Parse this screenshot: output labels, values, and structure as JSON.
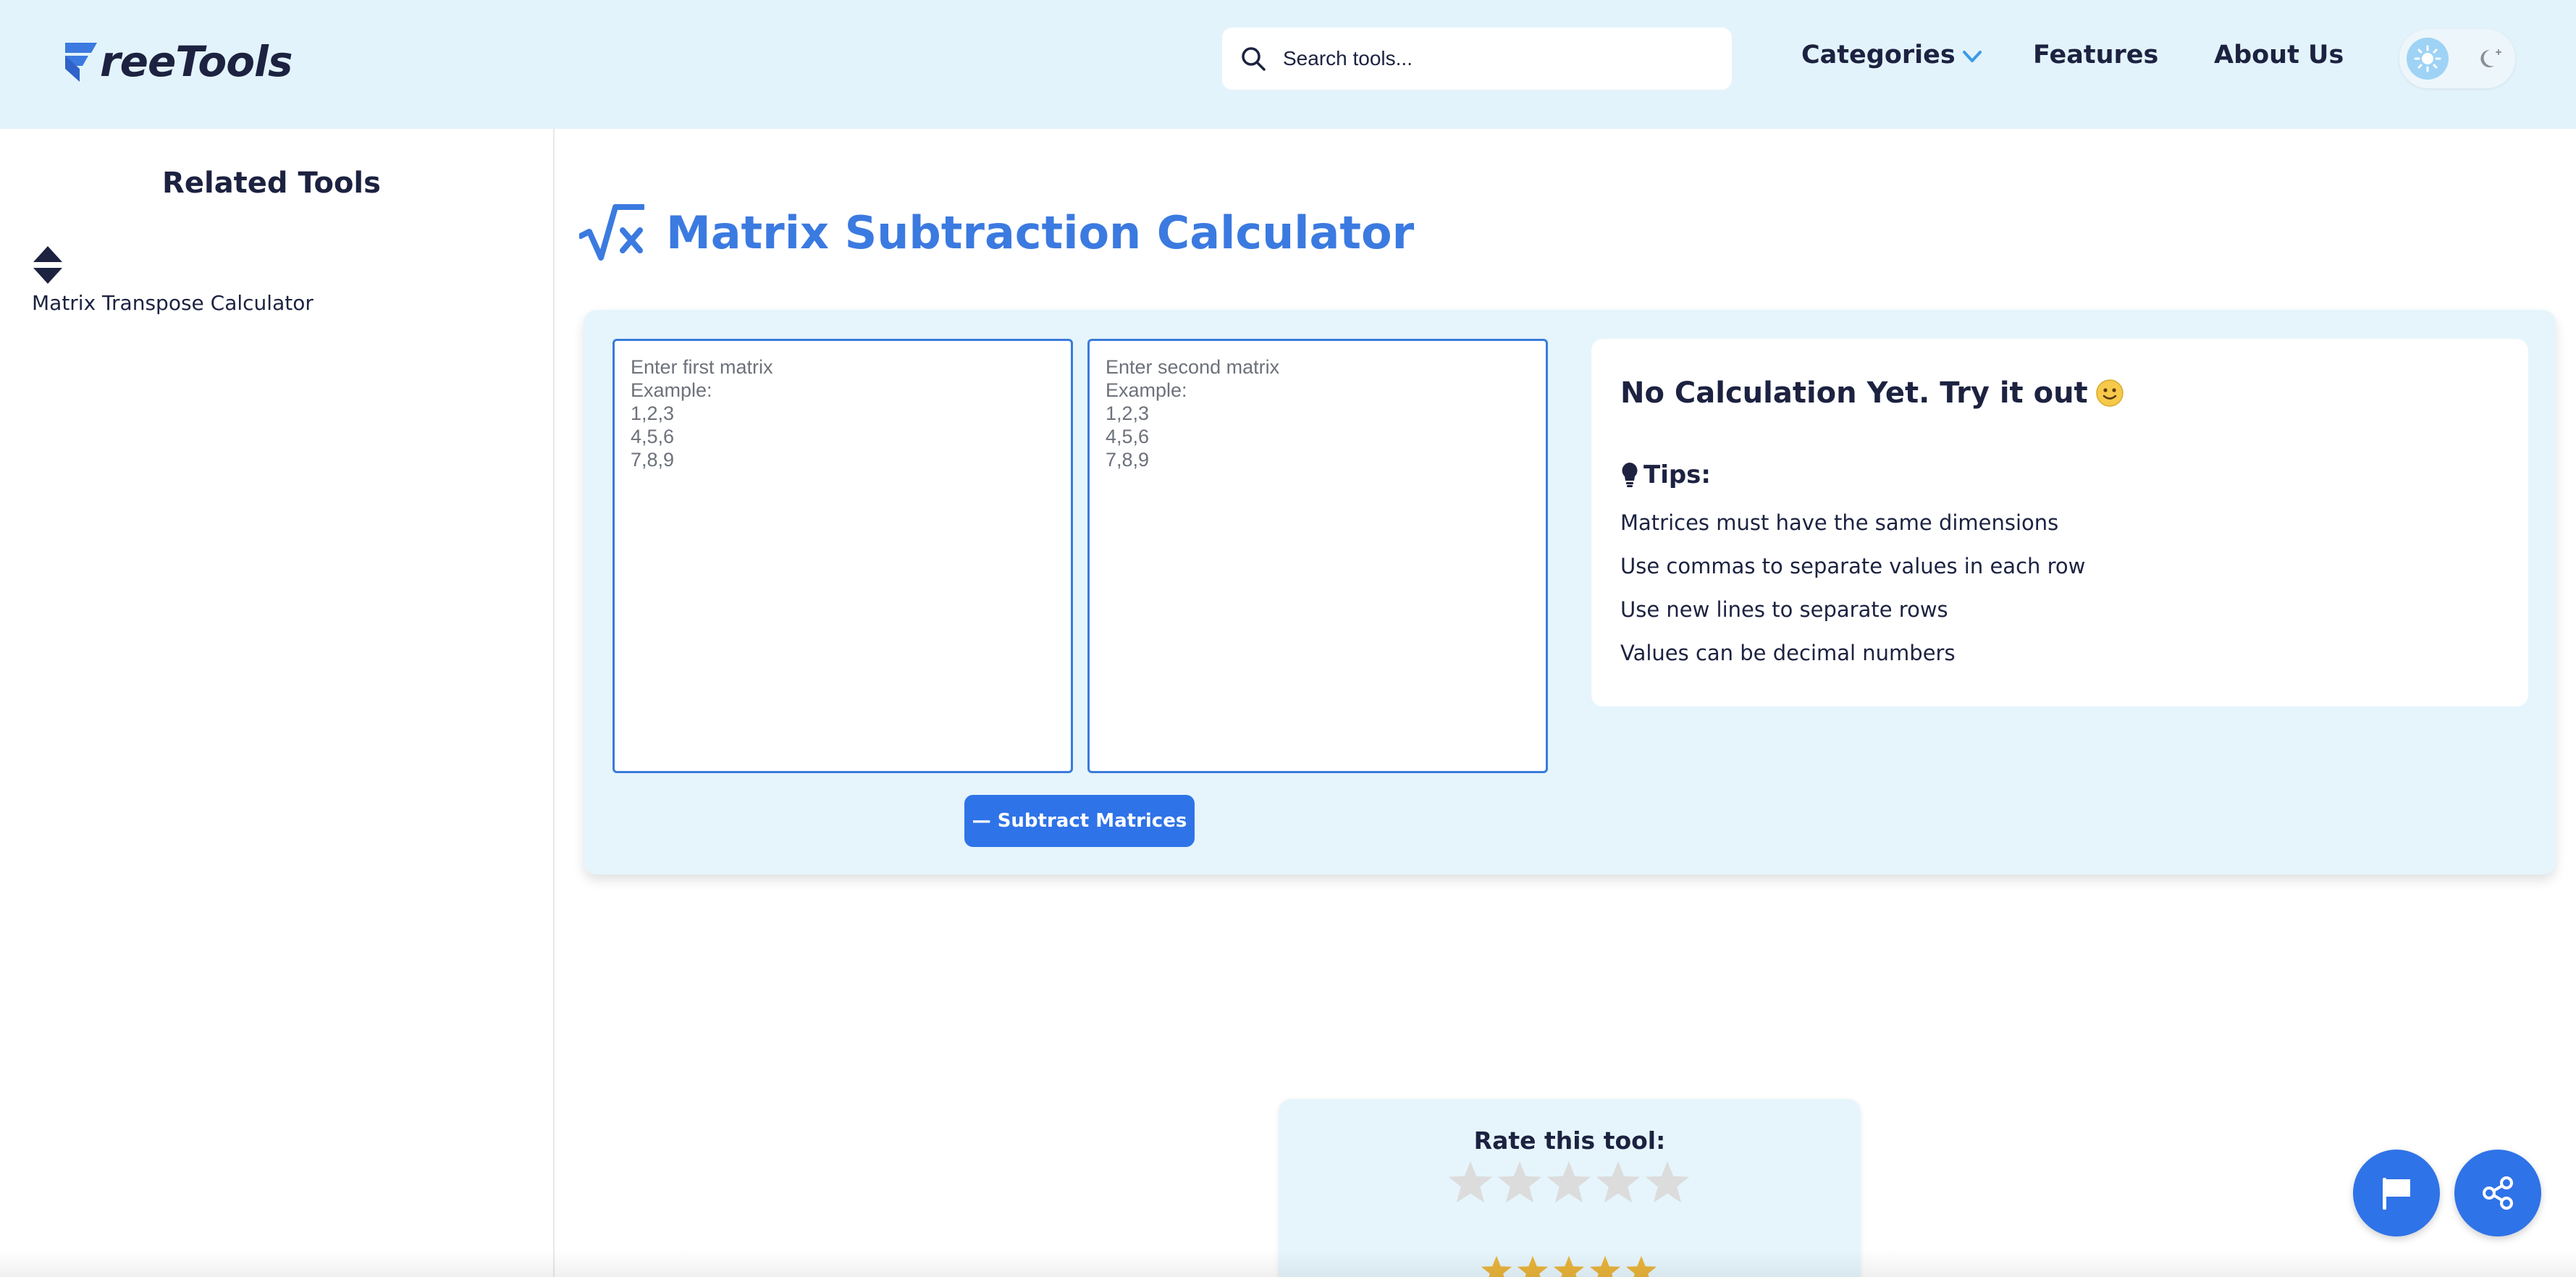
{
  "header": {
    "logo_text": "reeTools",
    "search": {
      "placeholder": "Search tools...",
      "value": ""
    },
    "nav": {
      "categories": "Categories",
      "features": "Features",
      "about": "About Us"
    },
    "theme_toggle": {
      "options": [
        "sun-icon",
        "moon-icon"
      ],
      "active": "light"
    }
  },
  "sidebar": {
    "title": "Related Tools",
    "items": [
      {
        "label": "Matrix Transpose Calculator",
        "icon": "sort-arrows-icon"
      }
    ]
  },
  "main": {
    "title": "Matrix Subtraction Calculator",
    "title_icon": "square-root-x-icon",
    "matrix_inputs": [
      {
        "placeholder": "Enter first matrix\nExample:\n1,2,3\n4,5,6\n7,8,9",
        "value": ""
      },
      {
        "placeholder": "Enter second matrix\nExample:\n1,2,3\n4,5,6\n7,8,9",
        "value": ""
      }
    ],
    "subtract_button": "— Subtract Matrices",
    "result": {
      "title": "No Calculation Yet. Try it out",
      "tips_heading": "Tips:",
      "tips": [
        "Matrices must have the same dimensions",
        "Use commas to separate values in each row",
        "Use new lines to separate rows",
        "Values can be decimal numbers"
      ]
    }
  },
  "rating": {
    "title": "Rate this tool:",
    "user_stars": 0,
    "max_stars": 5
  },
  "floating": {
    "report": "flag-icon",
    "share": "share-icon"
  },
  "colors": {
    "header_bg": "#e3f3fb",
    "accent": "#3b7ae0",
    "button": "#2f73e8",
    "panel_bg": "#e6f5fc",
    "text": "#1c2240",
    "star_empty": "#dcdcdc",
    "star_filled": "#e8b33a"
  }
}
